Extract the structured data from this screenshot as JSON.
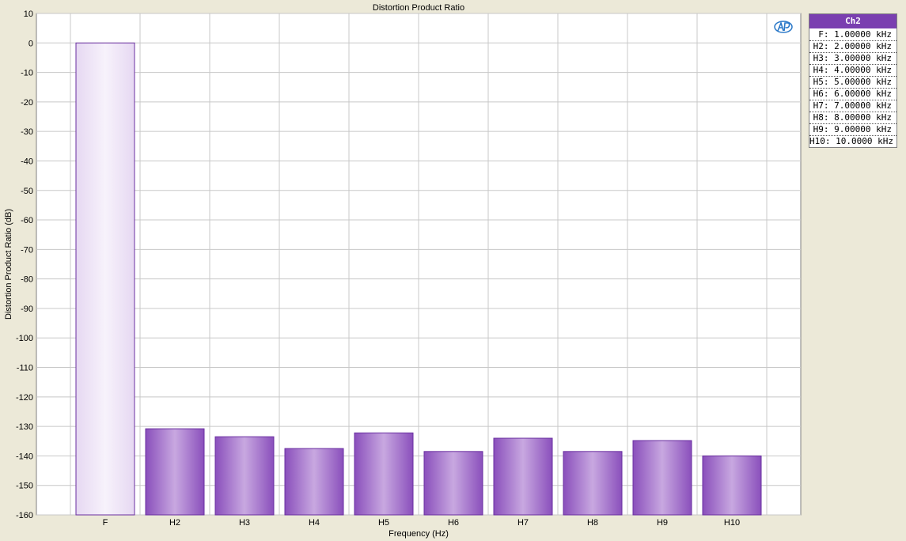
{
  "colors": {
    "bar_fundamental_fill": "#efe6f7",
    "bar_fill": "#9a63c4",
    "bar_stroke": "#6a2fa0",
    "legend_header": "#7a3fb0",
    "grid": "#c8c8c8",
    "logo": "#2a78c8"
  },
  "icons": {
    "logo": "ap-logo-icon"
  },
  "chart_data": {
    "type": "bar",
    "title": "Distortion Product Ratio",
    "xlabel": "Frequency (Hz)",
    "ylabel": "Distortion Product Ratio (dB)",
    "ylim": [
      -160,
      10
    ],
    "yticks": [
      10,
      0,
      -10,
      -20,
      -30,
      -40,
      -50,
      -60,
      -70,
      -80,
      -90,
      -100,
      -110,
      -120,
      -130,
      -140,
      -150,
      -160
    ],
    "grid": true,
    "legend_position": "right",
    "categories": [
      "F",
      "H2",
      "H3",
      "H4",
      "H5",
      "H6",
      "H7",
      "H8",
      "H9",
      "H10"
    ],
    "series": [
      {
        "name": "Ch2",
        "values": [
          0,
          -130.8,
          -133.5,
          -137.5,
          -132.2,
          -138.5,
          -134.0,
          -138.5,
          -134.8,
          -140.0
        ]
      }
    ],
    "legend": {
      "header": "Ch2",
      "entries": [
        "F: 1.00000 kHz",
        "H2: 2.00000 kHz",
        "H3: 3.00000 kHz",
        "H4: 4.00000 kHz",
        "H5: 5.00000 kHz",
        "H6: 6.00000 kHz",
        "H7: 7.00000 kHz",
        "H8: 8.00000 kHz",
        "H9: 9.00000 kHz",
        "H10: 10.0000 kHz"
      ]
    }
  }
}
